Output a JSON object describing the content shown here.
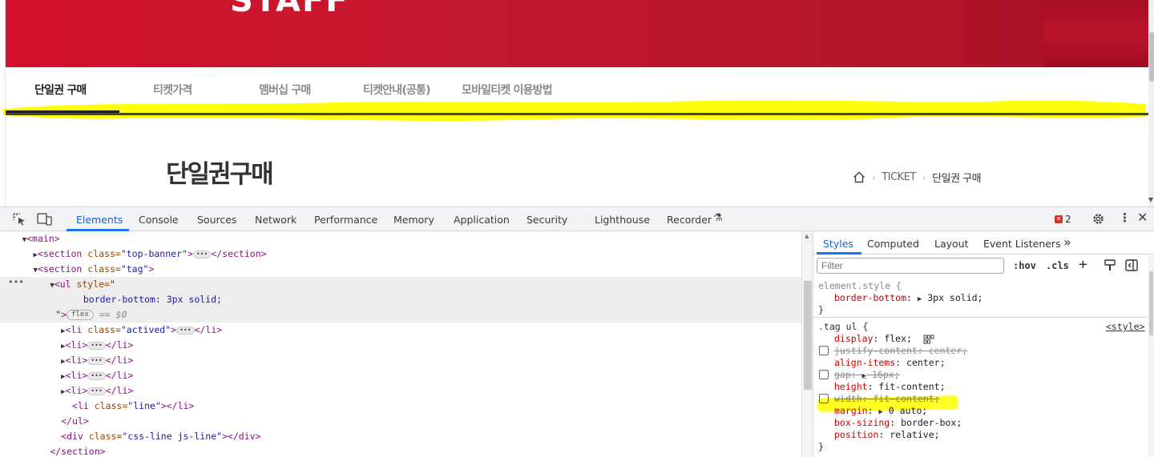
{
  "site": {
    "banner_text": "STAFF",
    "tabs": [
      {
        "label": "단일권 구매",
        "active": true
      },
      {
        "label": "티켓가격",
        "active": false
      },
      {
        "label": "맴버십 구매",
        "active": false
      },
      {
        "label": "티켓안내(공통)",
        "active": false
      },
      {
        "label": "모바일티켓 이용방법",
        "active": false
      }
    ],
    "page_title": "단일권구매",
    "breadcrumb": {
      "home_icon": "home-icon",
      "level1": "TICKET",
      "current": "단일권 구매"
    },
    "colors": {
      "banner": "#d4122c",
      "highlight": "#ffff00",
      "active_tab_text": "#222222"
    }
  },
  "devtools": {
    "tabs": [
      "Elements",
      "Console",
      "Sources",
      "Network",
      "Performance",
      "Memory",
      "Application",
      "Security",
      "Lighthouse",
      "Recorder"
    ],
    "active_tab": "Elements",
    "error_count": "2",
    "tree": {
      "main": "<main>",
      "top_banner_attr": "class=",
      "top_banner_val": "\"top-banner\"",
      "tag_section_val": "\"tag\"",
      "ul_style": "style=",
      "ul_style_value": "border-bottom: 3px solid;",
      "flex_badge": "flex",
      "dollar": "== $0",
      "li_actived_val": "\"actived\"",
      "li_line_val": "\"line\"",
      "div_css_line_val": "\"css-line js-line\""
    },
    "styles": {
      "tabs": [
        "Styles",
        "Computed",
        "Layout",
        "Event Listeners"
      ],
      "more": "»",
      "filter_placeholder": "Filter",
      "hov": ":hov",
      "cls": ".cls",
      "element_style_selector": "element.style {",
      "element_style_prop": "border-bottom",
      "element_style_val": "3px solid;",
      "tag_ul_selector": ".tag ul {",
      "source_link": "<style>",
      "declarations": [
        {
          "prop": "display",
          "val": "flex;",
          "struck": false,
          "checkbox": false
        },
        {
          "prop": "justify-content",
          "val": "center;",
          "struck": true,
          "checkbox": true
        },
        {
          "prop": "align-items",
          "val": "center;",
          "struck": false,
          "checkbox": false
        },
        {
          "prop": "gap",
          "val": "16px;",
          "struck": true,
          "checkbox": true
        },
        {
          "prop": "height",
          "val": "fit-content;",
          "struck": false,
          "checkbox": false
        },
        {
          "prop": "width",
          "val": "fit-content;",
          "struck": true,
          "checkbox": true
        },
        {
          "prop": "margin",
          "val": "0 auto;",
          "struck": false,
          "checkbox": false
        },
        {
          "prop": "box-sizing",
          "val": "border-box;",
          "struck": false,
          "checkbox": false
        },
        {
          "prop": "position",
          "val": "relative;",
          "struck": false,
          "checkbox": false
        }
      ]
    }
  }
}
